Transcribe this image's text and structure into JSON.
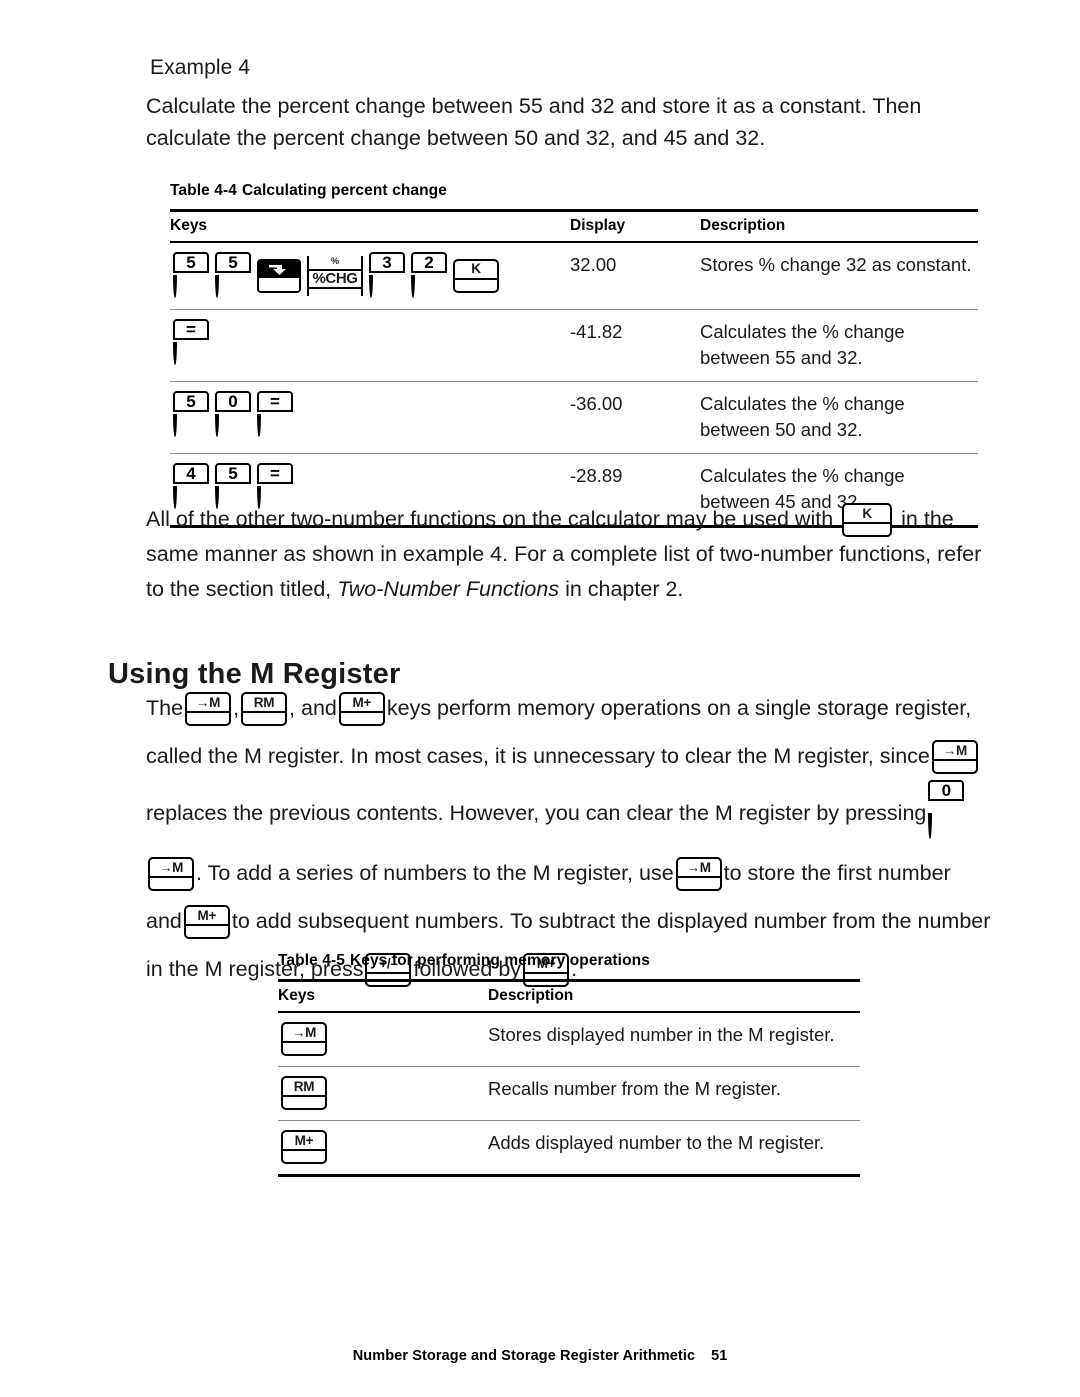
{
  "example": {
    "label": "Example 4",
    "paragraph": "Calculate the percent change between 55 and 32 and store it as a constant. Then calculate the percent change between 50 and 32, and 45 and 32."
  },
  "table_4_4": {
    "caption_number": "Table 4-4",
    "caption_title": "Calculating percent change",
    "columns": [
      "Keys",
      "Display",
      "Description"
    ],
    "rows": [
      {
        "keys": [
          {
            "type": "round",
            "label": "5"
          },
          {
            "type": "round",
            "label": "5"
          },
          {
            "type": "shift",
            "label": "shift-down-arrow"
          },
          {
            "type": "pct",
            "sup": "%",
            "label": "%CHG"
          },
          {
            "type": "round",
            "label": "3"
          },
          {
            "type": "round",
            "label": "2"
          },
          {
            "type": "flat",
            "label": "K"
          }
        ],
        "display": "32.00",
        "description": "Stores % change 32 as constant."
      },
      {
        "keys": [
          {
            "type": "round",
            "label": "="
          }
        ],
        "display": "-41.82",
        "description": "Calculates the % change between 55 and 32."
      },
      {
        "keys": [
          {
            "type": "round",
            "label": "5"
          },
          {
            "type": "round",
            "label": "0"
          },
          {
            "type": "round",
            "label": "="
          }
        ],
        "display": "-36.00",
        "description": "Calculates the % change between 50 and 32."
      },
      {
        "keys": [
          {
            "type": "round",
            "label": "4"
          },
          {
            "type": "round",
            "label": "5"
          },
          {
            "type": "round",
            "label": "="
          }
        ],
        "display": "-28.89",
        "description": "Calculates the % change between 45 and 32."
      }
    ]
  },
  "para_k": {
    "part1": "All of the other two-number functions on the calculator may be used with",
    "key": "K",
    "part2": "in the same manner as shown in example 4. For a complete list of two-number functions, refer to the section titled,",
    "italic": "Two-Number Functions",
    "part3": "in chapter 2."
  },
  "section": {
    "heading": "Using the M Register"
  },
  "m_register_para": {
    "s1": "The",
    "key1": "→M",
    "sep1": ",",
    "key2": "RM",
    "sep2": ", and",
    "key3": "M+",
    "s2": "keys perform memory operations on a single storage register, called the M register. In most cases, it is unnecessary to clear the M register, since",
    "key4": "→M",
    "s3": "replaces the previous contents. However, you can clear the M register by pressing",
    "key5": "0",
    "key6": "→M",
    "s4": ".",
    "s5": "To add a series of numbers to the M register, use",
    "key7": "→M",
    "s6": "to store the first number and",
    "key8": "M+",
    "s7": "to add subsequent numbers. To subtract the displayed number from the number in the M register, press",
    "key9": "+/–",
    "s8": "followed by",
    "key10": "M+",
    "s9": "."
  },
  "table_4_5": {
    "caption_number": "Table 4-5",
    "caption_title": "Keys for performing memory operations",
    "columns": [
      "Keys",
      "Description"
    ],
    "rows": [
      {
        "key": "→M",
        "description": "Stores displayed number in the M register."
      },
      {
        "key": "RM",
        "description": "Recalls number from the M register."
      },
      {
        "key": "M+",
        "description": "Adds displayed number to the M register."
      }
    ]
  },
  "footer": {
    "title": "Number Storage and Storage Register Arithmetic",
    "page": "51"
  }
}
